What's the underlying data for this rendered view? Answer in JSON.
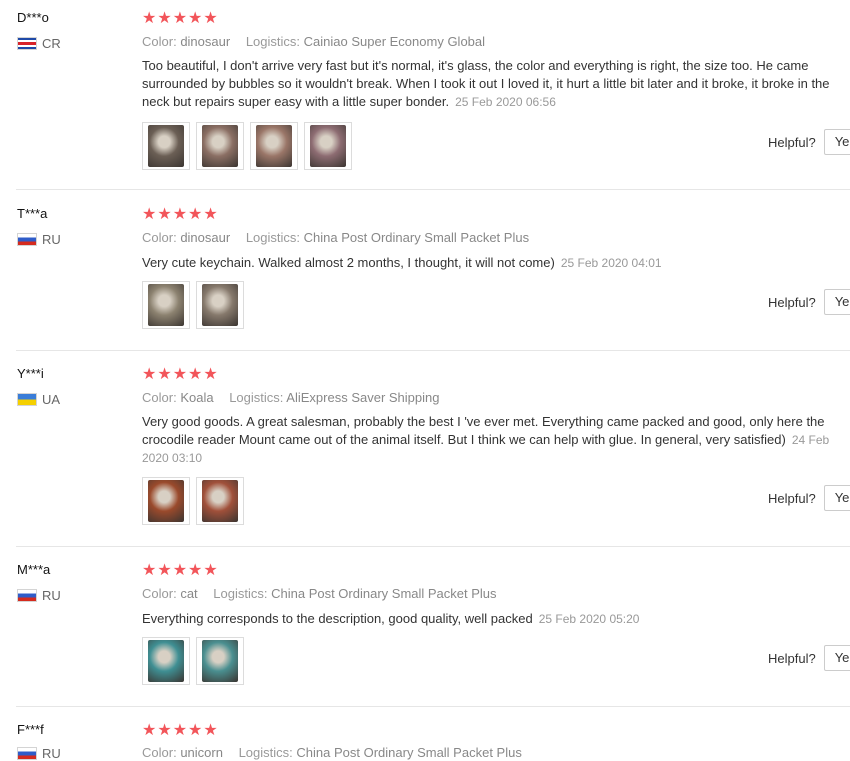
{
  "labels": {
    "color": "Color:",
    "logistics": "Logistics:",
    "helpful": "Helpful?",
    "yes": "Ye"
  },
  "stars": "★★★★★",
  "reviews": [
    {
      "user": "D***o",
      "country": "CR",
      "flag": "cr",
      "color": "dinosaur",
      "logistics": "Cainiao Super Economy Global",
      "text": "Too beautiful, I don't arrive very fast but it's normal, it's glass, the color and everything is right, the size too. He came surrounded by bubbles so it wouldn't break. When I took it out I loved it, it hurt a little bit later and it broke, it broke in the neck but repairs super easy with a little super bonder.",
      "date": "25 Feb 2020 06:56",
      "photos": [
        "#6b5f55",
        "#8b6f64",
        "#9a7668",
        "#8d6c72"
      ]
    },
    {
      "user": "T***a",
      "country": "RU",
      "flag": "ru",
      "color": "dinosaur",
      "logistics": "China Post Ordinary Small Packet Plus",
      "text": "Very cute keychain. Walked almost 2 months, I thought, it will not come)",
      "date": "25 Feb 2020 04:01",
      "photos": [
        "#8c8270",
        "#86796c"
      ]
    },
    {
      "user": "Y***i",
      "country": "UA",
      "flag": "ua",
      "color": "Koala",
      "logistics": "AliExpress Saver Shipping",
      "text": "Very good goods. A great salesman, probably the best I 've ever met. Everything came packed and good, only here the crocodile reader Mount came out of the animal itself. But I think we can help with glue. In general, very satisfied)",
      "date": "24 Feb 2020 03:10",
      "photos": [
        "#9a4a2c",
        "#a0503a"
      ]
    },
    {
      "user": "M***a",
      "country": "RU",
      "flag": "ru",
      "color": "cat",
      "logistics": "China Post Ordinary Small Packet Plus",
      "text": "Everything corresponds to the description, good quality, well packed",
      "date": "25 Feb 2020 05:20",
      "photos": [
        "#3f8f93",
        "#4a8f90"
      ]
    },
    {
      "user": "F***f",
      "country": "RU",
      "flag": "ru",
      "color": "unicorn",
      "logistics": "China Post Ordinary Small Packet Plus"
    }
  ]
}
